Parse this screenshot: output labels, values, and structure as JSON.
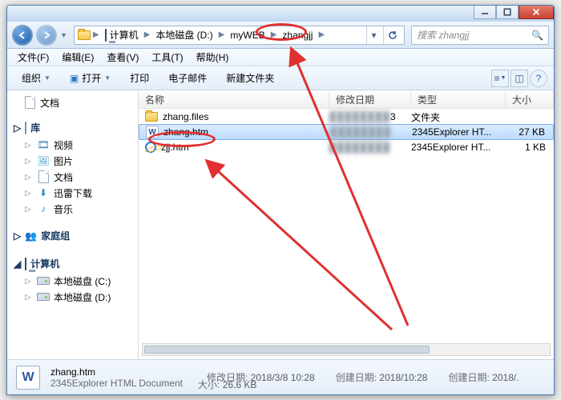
{
  "window_controls": {
    "min": "–",
    "max": "☐",
    "close": "×"
  },
  "breadcrumb": {
    "root_label": "计算机",
    "segs": [
      "本地磁盘 (D:)",
      "myWEB",
      "zhangjj"
    ]
  },
  "search": {
    "placeholder": "搜索 zhangjj"
  },
  "menu": {
    "file": "文件(F)",
    "edit": "编辑(E)",
    "view": "查看(V)",
    "tools": "工具(T)",
    "help": "帮助(H)"
  },
  "toolbar": {
    "organize": "组织",
    "open": "打开",
    "print": "打印",
    "email": "电子邮件",
    "newfolder": "新建文件夹"
  },
  "columns": {
    "name": "名称",
    "date": "修改日期",
    "type": "类型",
    "size": "大小"
  },
  "files": [
    {
      "name": "zhang.files",
      "date_blur": "3",
      "type": "文件夹",
      "size": ""
    },
    {
      "name": "zhang.htm",
      "date_blur": "",
      "type": "2345Explorer HT...",
      "size": "27 KB"
    },
    {
      "name": "zjj.htm",
      "date_blur": "",
      "type": "2345Explorer HT...",
      "size": "1 KB"
    }
  ],
  "tree": {
    "docs": "文档",
    "libraries": "库",
    "video": "视频",
    "pictures": "图片",
    "docs2": "文档",
    "xunlei": "迅雷下载",
    "music": "音乐",
    "homegroup": "家庭组",
    "computer": "计算机",
    "driveC": "本地磁盘 (C:)",
    "driveD": "本地磁盘 (D:)"
  },
  "status": {
    "name": "zhang.htm",
    "type": "2345Explorer HTML Document",
    "mod_k": "修改日期:",
    "mod_v": "2018/3/8 10:28",
    "size_k": "大小:",
    "size_v": "26.6 KB",
    "create_k": "创建日期:",
    "create_v": "2018/10:28",
    "create2_k": "创建日期:",
    "create2_v": "2018/."
  }
}
